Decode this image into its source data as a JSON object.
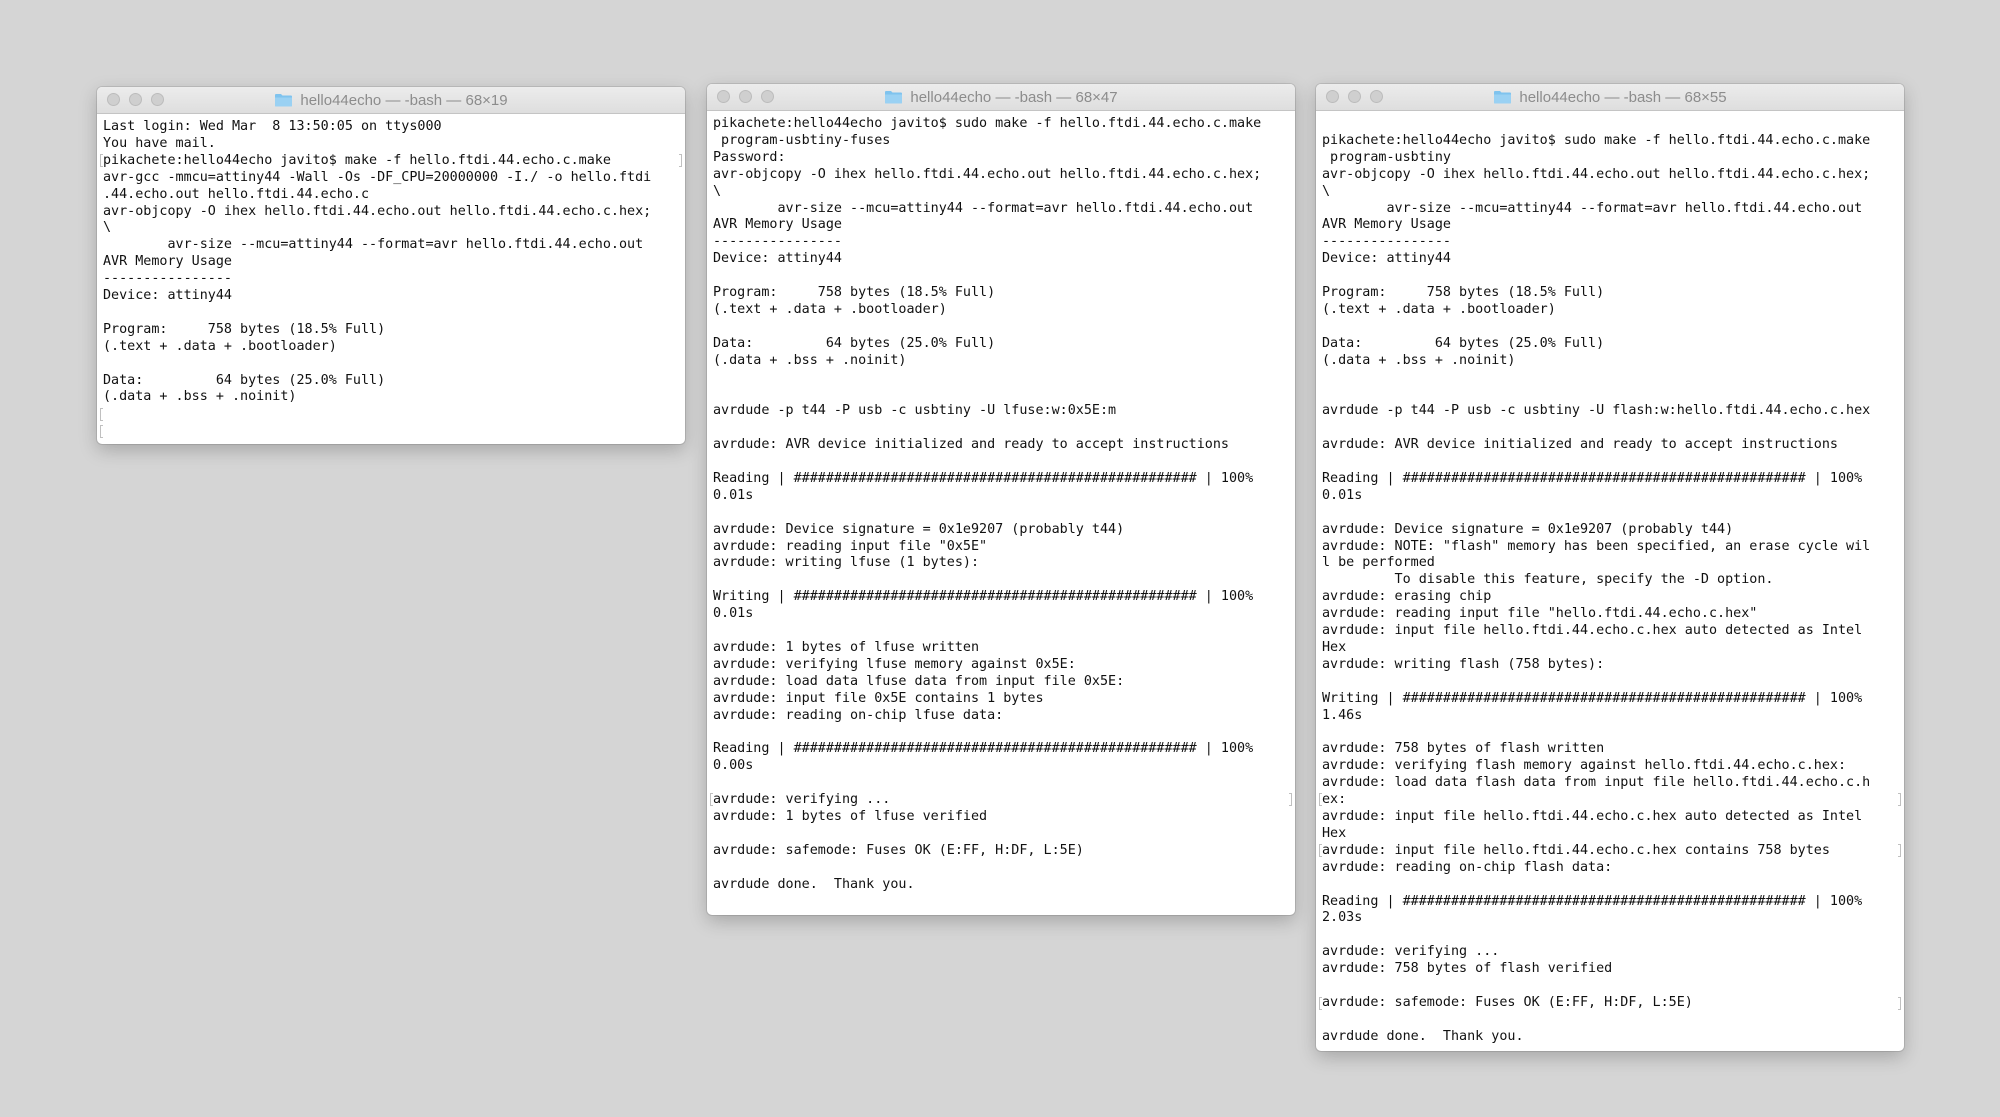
{
  "windows": [
    {
      "title": "hello44echo — -bash — 68×19",
      "lines": [
        "Last login: Wed Mar  8 13:50:05 on ttys000",
        "You have mail.",
        "pikachete:hello44echo javito$ make -f hello.ftdi.44.echo.c.make",
        "avr-gcc -mmcu=attiny44 -Wall -Os -DF_CPU=20000000 -I./ -o hello.ftdi",
        ".44.echo.out hello.ftdi.44.echo.c",
        "avr-objcopy -O ihex hello.ftdi.44.echo.out hello.ftdi.44.echo.c.hex;",
        "\\",
        "        avr-size --mcu=attiny44 --format=avr hello.ftdi.44.echo.out",
        "AVR Memory Usage",
        "----------------",
        "Device: attiny44",
        "",
        "Program:     758 bytes (18.5% Full)",
        "(.text + .data + .bootloader)",
        "",
        "Data:         64 bytes (25.0% Full)",
        "(.data + .bss + .noinit)",
        "",
        ""
      ]
    },
    {
      "title": "hello44echo — -bash — 68×47",
      "lines": [
        "pikachete:hello44echo javito$ sudo make -f hello.ftdi.44.echo.c.make",
        " program-usbtiny-fuses",
        "Password:",
        "avr-objcopy -O ihex hello.ftdi.44.echo.out hello.ftdi.44.echo.c.hex;",
        "\\",
        "        avr-size --mcu=attiny44 --format=avr hello.ftdi.44.echo.out",
        "AVR Memory Usage",
        "----------------",
        "Device: attiny44",
        "",
        "Program:     758 bytes (18.5% Full)",
        "(.text + .data + .bootloader)",
        "",
        "Data:         64 bytes (25.0% Full)",
        "(.data + .bss + .noinit)",
        "",
        "",
        "avrdude -p t44 -P usb -c usbtiny -U lfuse:w:0x5E:m",
        "",
        "avrdude: AVR device initialized and ready to accept instructions",
        "",
        "Reading | ################################################## | 100%",
        "0.01s",
        "",
        "avrdude: Device signature = 0x1e9207 (probably t44)",
        "avrdude: reading input file \"0x5E\"",
        "avrdude: writing lfuse (1 bytes):",
        "",
        "Writing | ################################################## | 100%",
        "0.01s",
        "",
        "avrdude: 1 bytes of lfuse written",
        "avrdude: verifying lfuse memory against 0x5E:",
        "avrdude: load data lfuse data from input file 0x5E:",
        "avrdude: input file 0x5E contains 1 bytes",
        "avrdude: reading on-chip lfuse data:",
        "",
        "Reading | ################################################## | 100%",
        "0.00s",
        "",
        "avrdude: verifying ...",
        "avrdude: 1 bytes of lfuse verified",
        "",
        "avrdude: safemode: Fuses OK (E:FF, H:DF, L:5E)",
        "",
        "avrdude done.  Thank you.",
        ""
      ]
    },
    {
      "title": "hello44echo — -bash — 68×55",
      "lines": [
        "",
        "pikachete:hello44echo javito$ sudo make -f hello.ftdi.44.echo.c.make",
        " program-usbtiny",
        "avr-objcopy -O ihex hello.ftdi.44.echo.out hello.ftdi.44.echo.c.hex;",
        "\\",
        "        avr-size --mcu=attiny44 --format=avr hello.ftdi.44.echo.out",
        "AVR Memory Usage",
        "----------------",
        "Device: attiny44",
        "",
        "Program:     758 bytes (18.5% Full)",
        "(.text + .data + .bootloader)",
        "",
        "Data:         64 bytes (25.0% Full)",
        "(.data + .bss + .noinit)",
        "",
        "",
        "avrdude -p t44 -P usb -c usbtiny -U flash:w:hello.ftdi.44.echo.c.hex",
        "",
        "avrdude: AVR device initialized and ready to accept instructions",
        "",
        "Reading | ################################################## | 100%",
        "0.01s",
        "",
        "avrdude: Device signature = 0x1e9207 (probably t44)",
        "avrdude: NOTE: \"flash\" memory has been specified, an erase cycle wil",
        "l be performed",
        "         To disable this feature, specify the -D option.",
        "avrdude: erasing chip",
        "avrdude: reading input file \"hello.ftdi.44.echo.c.hex\"",
        "avrdude: input file hello.ftdi.44.echo.c.hex auto detected as Intel",
        "Hex",
        "avrdude: writing flash (758 bytes):",
        "",
        "Writing | ################################################## | 100%",
        "1.46s",
        "",
        "avrdude: 758 bytes of flash written",
        "avrdude: verifying flash memory against hello.ftdi.44.echo.c.hex:",
        "avrdude: load data flash data from input file hello.ftdi.44.echo.c.h",
        "ex:",
        "avrdude: input file hello.ftdi.44.echo.c.hex auto detected as Intel",
        "Hex",
        "avrdude: input file hello.ftdi.44.echo.c.hex contains 758 bytes",
        "avrdude: reading on-chip flash data:",
        "",
        "Reading | ################################################## | 100%",
        "2.03s",
        "",
        "avrdude: verifying ...",
        "avrdude: 758 bytes of flash verified",
        "",
        "avrdude: safemode: Fuses OK (E:FF, H:DF, L:5E)",
        "",
        "avrdude done.  Thank you."
      ]
    }
  ],
  "icons": {
    "folder": "folder-icon",
    "close": "close-button",
    "minimize": "minimize-button",
    "zoom": "zoom-button"
  },
  "colors": {
    "folder": "#7fc3ee",
    "background": "#d5d5d5",
    "terminal_text": "#111111",
    "title_text": "#8c8c8c"
  }
}
